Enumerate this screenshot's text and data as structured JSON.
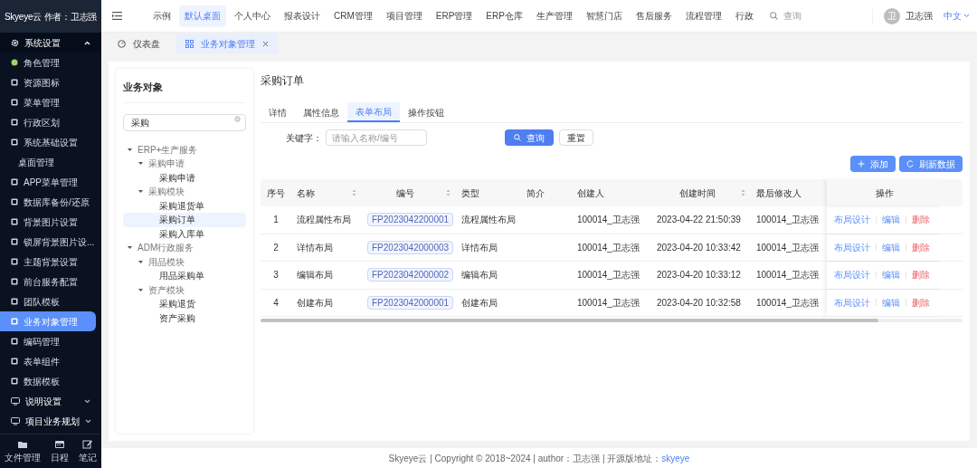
{
  "brand": "Skyeye云 作者：卫志强",
  "top_nav": [
    {
      "label": "示例",
      "selected": false
    },
    {
      "label": "默认桌面",
      "selected": true
    },
    {
      "label": "个人中心",
      "selected": false
    },
    {
      "label": "报表设计",
      "selected": false
    },
    {
      "label": "CRM管理",
      "selected": false
    },
    {
      "label": "项目管理",
      "selected": false
    },
    {
      "label": "ERP管理",
      "selected": false
    },
    {
      "label": "ERP仓库",
      "selected": false
    },
    {
      "label": "生产管理",
      "selected": false
    },
    {
      "label": "智慧门店",
      "selected": false
    },
    {
      "label": "售后服务",
      "selected": false
    },
    {
      "label": "流程管理",
      "selected": false
    },
    {
      "label": "行政",
      "selected": false
    }
  ],
  "search": {
    "placeholder": "查询"
  },
  "user": {
    "avatar": "卫",
    "name": "卫志强",
    "language": "中文"
  },
  "sidebar": {
    "groups": [
      {
        "label": "系统设置",
        "expanded": true,
        "items": [
          {
            "label": "角色管理",
            "has_icon": true,
            "selected": false
          },
          {
            "label": "资源图标",
            "has_icon": true,
            "selected": false
          },
          {
            "label": "菜单管理",
            "has_icon": true,
            "selected": false
          },
          {
            "label": "行政区划",
            "has_icon": true,
            "selected": false
          },
          {
            "label": "系统基础设置",
            "has_icon": true,
            "selected": false
          },
          {
            "label": "桌面管理",
            "has_icon": false,
            "selected": false
          },
          {
            "label": "APP菜单管理",
            "has_icon": true,
            "selected": false
          },
          {
            "label": "数据库备份/还原",
            "has_icon": true,
            "selected": false
          },
          {
            "label": "背景图片设置",
            "has_icon": true,
            "selected": false
          },
          {
            "label": "锁屏背景图片设...",
            "has_icon": true,
            "selected": false
          },
          {
            "label": "主题背景设置",
            "has_icon": true,
            "selected": false
          },
          {
            "label": "前台服务配置",
            "has_icon": true,
            "selected": false
          },
          {
            "label": "团队模板",
            "has_icon": true,
            "selected": false
          },
          {
            "label": "业务对象管理",
            "has_icon": true,
            "selected": true
          },
          {
            "label": "编码管理",
            "has_icon": true,
            "selected": false
          },
          {
            "label": "表单组件",
            "has_icon": true,
            "selected": false
          },
          {
            "label": "数据模板",
            "has_icon": true,
            "selected": false
          }
        ]
      },
      {
        "label": "说明设置",
        "expanded": false
      },
      {
        "label": "项目业务规划",
        "expanded": false
      }
    ],
    "dock": [
      "文件管理",
      "日程",
      "笔记"
    ]
  },
  "page_tabs": [
    {
      "label": "仪表盘",
      "selected": false,
      "closable": false
    },
    {
      "label": "业务对象管理",
      "selected": true,
      "closable": true
    }
  ],
  "tree_panel": {
    "title": "业务对象",
    "search_value": "采购",
    "tree": [
      {
        "label": "ERP+生产服务",
        "expanded": true,
        "children": [
          {
            "label": "采购申请",
            "expanded": true,
            "children": [
              {
                "label": "采购申请",
                "selected": false
              }
            ]
          },
          {
            "label": "采购模块",
            "expanded": true,
            "children": [
              {
                "label": "采购退货单",
                "selected": false
              },
              {
                "label": "采购订单",
                "selected": true
              },
              {
                "label": "采购入库单",
                "selected": false
              }
            ]
          }
        ]
      },
      {
        "label": "ADM行政服务",
        "expanded": true,
        "children": [
          {
            "label": "用品模块",
            "expanded": true,
            "children": [
              {
                "label": "用品采购单",
                "selected": false
              }
            ]
          },
          {
            "label": "资产模块",
            "expanded": true,
            "children": [
              {
                "label": "采购退货",
                "selected": false
              },
              {
                "label": "资产采购",
                "selected": false
              }
            ]
          }
        ]
      }
    ]
  },
  "detail": {
    "title": "采购订单",
    "tabs": [
      {
        "label": "详情",
        "selected": false
      },
      {
        "label": "属性信息",
        "selected": false
      },
      {
        "label": "表单布局",
        "selected": true
      },
      {
        "label": "操作按钮",
        "selected": false
      }
    ],
    "filter": {
      "label": "关键字：",
      "placeholder": "请输入名称/编号",
      "search_button": "查询",
      "reset_button": "重置"
    },
    "toolbar": [
      {
        "label": "添加",
        "kind": "add"
      },
      {
        "label": "刷新数据",
        "kind": "refresh"
      }
    ],
    "table": {
      "columns": [
        {
          "label": "序号",
          "sortable": false
        },
        {
          "label": "名称",
          "sortable": true
        },
        {
          "label": "编号",
          "sortable": true
        },
        {
          "label": "类型",
          "sortable": false
        },
        {
          "label": "简介",
          "sortable": false
        },
        {
          "label": "创建人",
          "sortable": false
        },
        {
          "label": "创建时间",
          "sortable": true
        },
        {
          "label": "最后修改人",
          "sortable": false
        },
        {
          "label": "操作",
          "sortable": false
        }
      ],
      "rows": [
        {
          "index": "1",
          "name": "流程属性布局",
          "code": "FP2023042200001",
          "type": "流程属性布局",
          "creator": "100014_卫志强",
          "created": "2023-04-22 21:50:39",
          "modifier": "100014_卫志强",
          "actions": [
            {
              "label": "布局设计",
              "kind": "normal"
            },
            {
              "label": "编辑",
              "kind": "normal"
            },
            {
              "label": "删除",
              "kind": "danger"
            }
          ]
        },
        {
          "index": "2",
          "name": "详情布局",
          "code": "FP2023042000003",
          "type": "详情布局",
          "creator": "100014_卫志强",
          "created": "2023-04-20 10:33:42",
          "modifier": "100014_卫志强",
          "actions": [
            {
              "label": "布局设计",
              "kind": "normal"
            },
            {
              "label": "编辑",
              "kind": "normal"
            },
            {
              "label": "删除",
              "kind": "danger"
            }
          ]
        },
        {
          "index": "3",
          "name": "编辑布局",
          "code": "FP2023042000002",
          "type": "编辑布局",
          "creator": "100014_卫志强",
          "created": "2023-04-20 10:33:12",
          "modifier": "100014_卫志强",
          "actions": [
            {
              "label": "布局设计",
              "kind": "normal"
            },
            {
              "label": "编辑",
              "kind": "normal"
            },
            {
              "label": "删除",
              "kind": "danger"
            }
          ]
        },
        {
          "index": "4",
          "name": "创建布局",
          "code": "FP2023042000001",
          "type": "创建布局",
          "creator": "100014_卫志强",
          "created": "2023-04-20 10:32:58",
          "modifier": "100014_卫志强",
          "actions": [
            {
              "label": "布局设计",
              "kind": "normal"
            },
            {
              "label": "编辑",
              "kind": "normal"
            },
            {
              "label": "删除",
              "kind": "danger"
            }
          ]
        }
      ]
    }
  },
  "footer": {
    "text": "Skyeye云 | Copyright © 2018~2024 | author：卫志强 | 开源版地址：",
    "link": "skyeye"
  }
}
